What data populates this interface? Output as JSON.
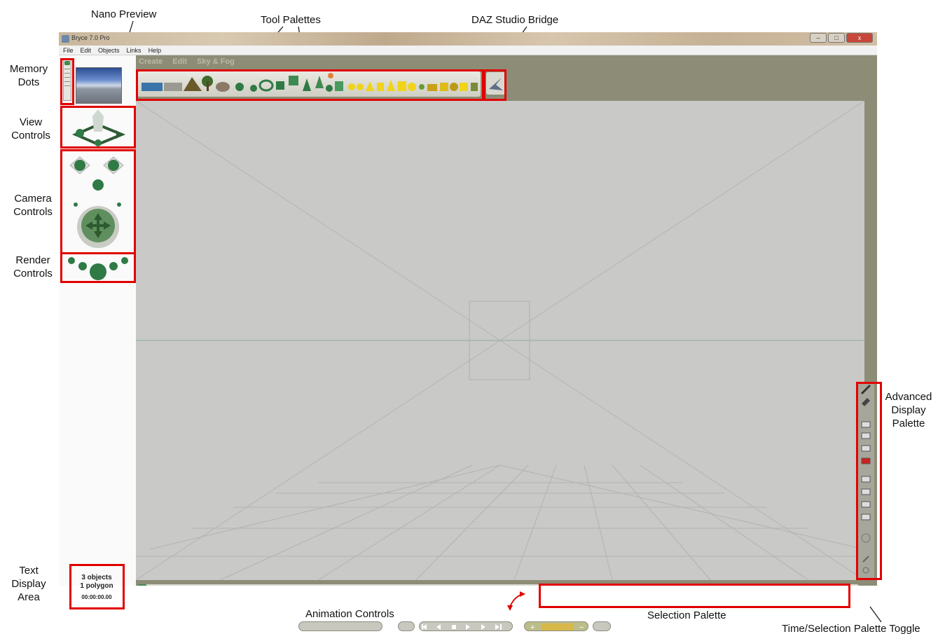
{
  "window": {
    "title": "Bryce 7.0 Pro",
    "menu": [
      "File",
      "Edit",
      "Objects",
      "Links",
      "Help"
    ],
    "tabs": [
      "Create",
      "Edit",
      "Sky & Fog"
    ],
    "controls": {
      "minimize": "–",
      "maximize": "□",
      "close": "x"
    }
  },
  "status": {
    "objects": "3 objects",
    "polygons": "1 polygon",
    "time": "00:00:00.00"
  },
  "annotations": {
    "nano_preview": "Nano Preview",
    "tool_palettes": "Tool Palettes",
    "daz_bridge": "DAZ Studio Bridge",
    "memory_dots": "Memory\nDots",
    "view_controls": "View\nControls",
    "camera_controls": "Camera\nControls",
    "render_controls": "Render\nControls",
    "text_display": "Text\nDisplay\nArea",
    "advanced_display": "Advanced\nDisplay\nPalette",
    "animation_controls": "Animation Controls",
    "selection_palette": "Selection Palette",
    "time_selection_toggle": "Time/Selection Palette Toggle"
  },
  "icons": {
    "memory_dots": "memory-dots-icon",
    "nano_preview": "nano-preview-image",
    "view_controls": "view-cube-icon",
    "camera_trackball": "camera-trackball-icon",
    "render_spheres": "render-spheres-icon",
    "daz_bridge": "daz-bridge-icon",
    "toggle": "palette-toggle-icon"
  },
  "colors": {
    "annotation_box": "#e10000",
    "viewport_bg": "#c9c9c7",
    "app_bg": "#8d8d77",
    "sphere_green": "#2f7a45",
    "primitive_yellow": "#f1d31a"
  }
}
